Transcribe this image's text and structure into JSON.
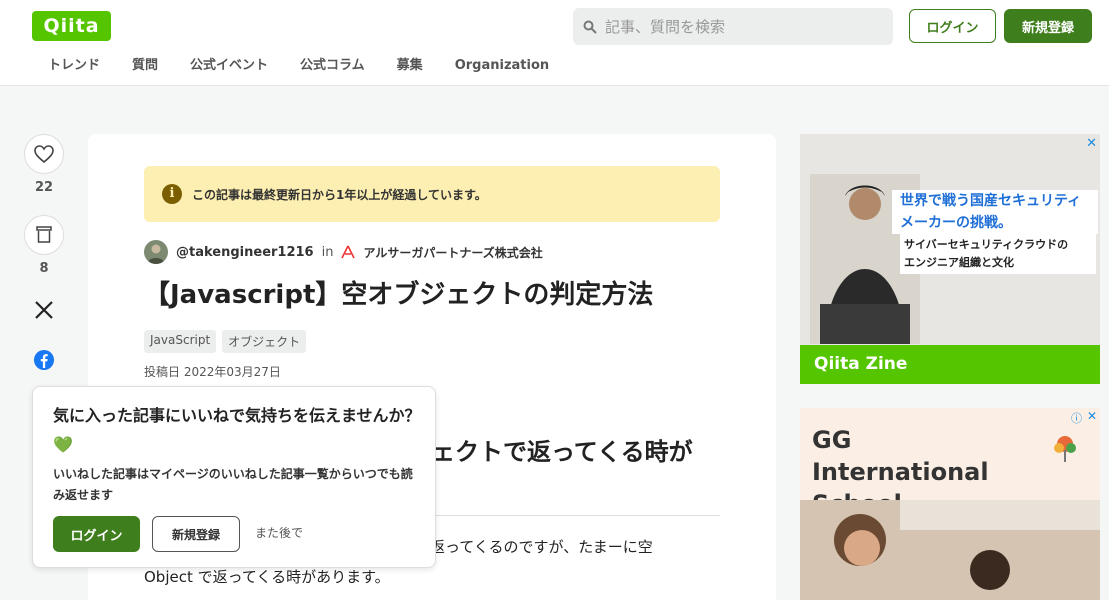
{
  "header": {
    "logo": "Qiita",
    "search_placeholder": "記事、質問を検索",
    "login_label": "ログイン",
    "signup_label": "新規登録",
    "nav": [
      "トレンド",
      "質問",
      "公式イベント",
      "公式コラム",
      "募集",
      "Organization"
    ]
  },
  "sidebar": {
    "likes": "22",
    "stocks": "8"
  },
  "article": {
    "notice": "この記事は最終更新日から1年以上が経過しています。",
    "author": "@takengineer1216",
    "in": "in",
    "org": "アルサーガパートナーズ株式会社",
    "title": "【Javascript】空オブジェクトの判定方法",
    "tags": [
      "JavaScript",
      "オブジェクト"
    ],
    "posted": "投稿日 2022年03月27日",
    "heading": "ェクトで返ってくる時が",
    "paragraph_line1": "返ってくるのですが、たまーに空",
    "paragraph_line2": "Object で返ってくる時があります。"
  },
  "popup": {
    "heading": "気に入った記事にいいねで気持ちを伝えませんか？💚",
    "desc": "いいねした記事はマイページのいいねした記事一覧からいつでも読み返せます",
    "login_label": "ログイン",
    "signup_label": "新規登録",
    "later_label": "また後で"
  },
  "ads": {
    "ad1_close": "✕",
    "ad1_line1": "世界で戦う国産セキュリティ",
    "ad1_line2": "メーカーの挑戦。",
    "ad1_sub1": "サイバーセキュリティクラウドの",
    "ad1_sub2": "エンジニア組織と文化",
    "ad1_footer": "Qiita Zine",
    "ad2_name": "GG International School",
    "ad2_info": "ⓘ",
    "ad2_close": "✕"
  },
  "colors": {
    "brand": "#55c500",
    "button": "#3f7e1c",
    "notice_bg": "#fcefb1"
  }
}
